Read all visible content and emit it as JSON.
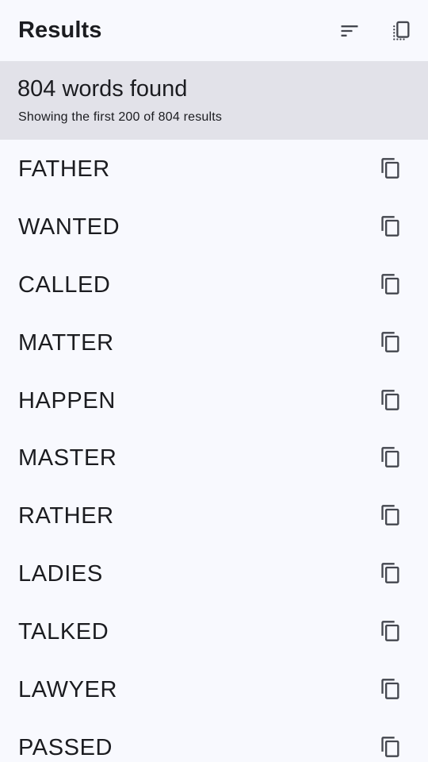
{
  "header": {
    "title": "Results",
    "sort_icon": "sort-icon",
    "copy_all_icon": "copy-all-icon"
  },
  "summary": {
    "count_text": "804 words found",
    "detail_text": "Showing the first 200 of 804 results"
  },
  "results": [
    {
      "word": "FATHER",
      "icon": "copy-icon"
    },
    {
      "word": "WANTED",
      "icon": "copy-icon"
    },
    {
      "word": "CALLED",
      "icon": "copy-icon"
    },
    {
      "word": "MATTER",
      "icon": "copy-icon"
    },
    {
      "word": "HAPPEN",
      "icon": "copy-icon"
    },
    {
      "word": "MASTER",
      "icon": "copy-icon"
    },
    {
      "word": "RATHER",
      "icon": "copy-icon"
    },
    {
      "word": "LADIES",
      "icon": "copy-icon"
    },
    {
      "word": "TALKED",
      "icon": "copy-icon"
    },
    {
      "word": "LAWYER",
      "icon": "copy-icon"
    },
    {
      "word": "PASSED",
      "icon": "copy-icon"
    }
  ],
  "colors": {
    "background": "#f8f9fe",
    "summary_background": "#e2e2e9",
    "text": "#1b1c20",
    "icon": "#44474f"
  }
}
